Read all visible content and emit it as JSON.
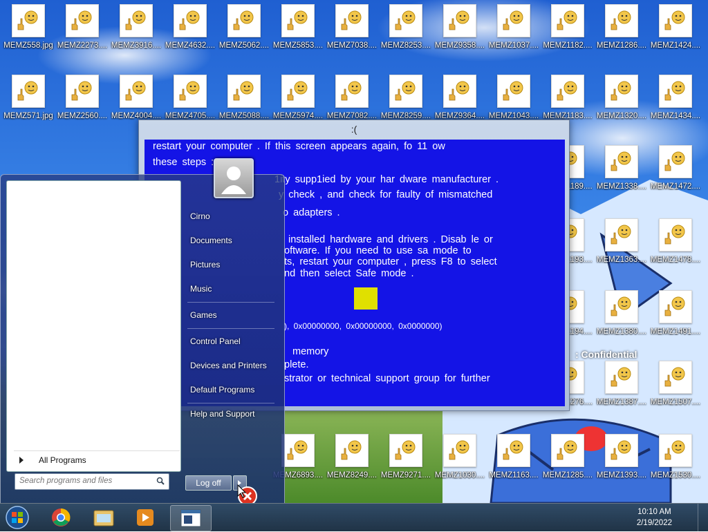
{
  "desktop_icons": [
    {
      "label": "MEMZ558.jpg"
    },
    {
      "label": "MEMZ2273...."
    },
    {
      "label": "MEMZ3916...."
    },
    {
      "label": "MEMZ4632...."
    },
    {
      "label": "MEMZ5062...."
    },
    {
      "label": "MEMZ5853...."
    },
    {
      "label": "MEMZ7038...."
    },
    {
      "label": "MEMZ8253...."
    },
    {
      "label": "MEMZ9358...."
    },
    {
      "label": "MEMZ1037...."
    },
    {
      "label": "MEMZ1182...."
    },
    {
      "label": "MEMZ1286...."
    },
    {
      "label": "MEMZ1424...."
    },
    {
      "label": "MEMZ571.jpg"
    },
    {
      "label": "MEMZ2560...."
    },
    {
      "label": "MEMZ4004...."
    },
    {
      "label": "MEMZ4705...."
    },
    {
      "label": "MEMZ5088...."
    },
    {
      "label": "MEMZ5974...."
    },
    {
      "label": "MEMZ7082...."
    },
    {
      "label": "MEMZ8259...."
    },
    {
      "label": "MEMZ9364...."
    },
    {
      "label": "MEMZ1043...."
    },
    {
      "label": "MEMZ1183...."
    },
    {
      "label": "MEMZ1320...."
    },
    {
      "label": "MEMZ1434...."
    },
    {
      "label": "MEMZ1189...."
    },
    {
      "label": "MEMZ1338...."
    },
    {
      "label": "MEMZ1472...."
    },
    {
      "label": "MEMZ1193...."
    },
    {
      "label": "MEMZ1363...."
    },
    {
      "label": "MEMZ1478...."
    },
    {
      "label": "MEMZ1194...."
    },
    {
      "label": "MEMZ1380...."
    },
    {
      "label": "MEMZ1491...."
    },
    {
      "label": "MEMZ1276...."
    },
    {
      "label": "MEMZ1387...."
    },
    {
      "label": "MEMZ1507...."
    },
    {
      "label": "MEMZ6893...."
    },
    {
      "label": "MEMZ8249...."
    },
    {
      "label": "MEMZ9271...."
    },
    {
      "label": "MEMZ1030...."
    },
    {
      "label": "MEMZ1163...."
    },
    {
      "label": "MEMZ1285...."
    },
    {
      "label": "MEMZ1393...."
    },
    {
      "label": "MEMZ1530...."
    }
  ],
  "bsod": {
    "title": ":(",
    "lines": [
      "restart your computer . If this screen appears again, fo 11 ow",
      "these steps :",
      "1ity supp1ied by your har dware manufacturer .",
      "y check , and check for faulty of mismatched",
      "o adapters .",
      "installed hardware and drivers . Disab le or",
      "oftware. If you need to use sa mode to",
      "ts, restart your computer , press F8 to select",
      "nd then select Safe mode .",
      "), 0x00000000, 0x00000000, 0x0000000)",
      "memory",
      "plete.",
      "strator or technical support group for further"
    ]
  },
  "start_menu": {
    "right_links": [
      {
        "label": "Cirno"
      },
      {
        "label": "Documents"
      },
      {
        "label": "Pictures"
      },
      {
        "label": "Music"
      },
      {
        "label": "Games"
      },
      {
        "label": "Control Panel"
      },
      {
        "label": "Devices and Printers"
      },
      {
        "label": "Default Programs"
      },
      {
        "label": "Help and Support"
      }
    ],
    "all_programs": "All Programs",
    "search_placeholder": "Search programs and files",
    "logoff_label": "Log off"
  },
  "overlay_text": {
    "confidential": ": Confidential"
  },
  "taskbar": {
    "icons": [
      "windows-start-icon",
      "chrome-icon",
      "file-explorer-icon",
      "media-player-icon",
      "memz-window-icon"
    ],
    "time": "10:10 AM",
    "date": "2/19/2022"
  }
}
